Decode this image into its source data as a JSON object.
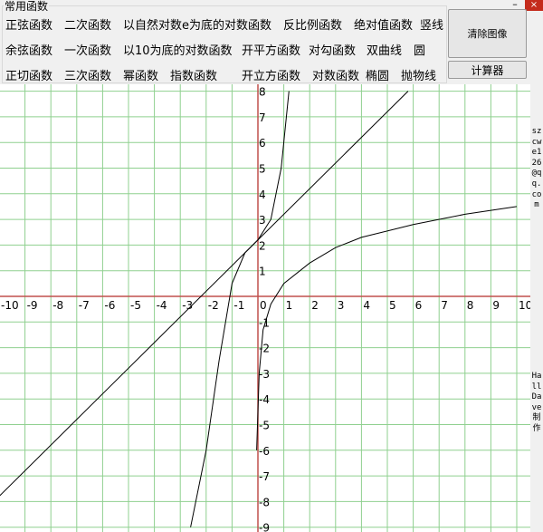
{
  "window": {
    "close_glyph": "×",
    "minimize_glyph": "–"
  },
  "group": {
    "title": "常用函数",
    "rows": [
      [
        "正弦函数",
        "二次函数",
        "以自然对数e为底的对数函数",
        "反比例函数",
        "绝对值函数",
        "竖线"
      ],
      [
        "余弦函数",
        "一次函数",
        "以10为底的对数函数",
        "开平方函数",
        "对勾函数",
        "双曲线",
        "圆"
      ],
      [
        "正切函数",
        "三次函数",
        "幂函数",
        "指数函数",
        "开立方函数",
        "对数函数",
        "椭圆",
        "抛物线"
      ]
    ]
  },
  "buttons": {
    "clear": "清除图像",
    "calculator": "计算器"
  },
  "side": {
    "email": "szcwe126@qq.com",
    "credit": "HallDave制作"
  },
  "chart_data": {
    "type": "line",
    "xlim": [
      -10,
      10
    ],
    "ylim": [
      -9,
      8
    ],
    "grid": true,
    "x_ticks": [
      -10,
      -9,
      -8,
      -7,
      -6,
      -5,
      -4,
      -3,
      -2,
      -1,
      0,
      1,
      2,
      3,
      4,
      5,
      6,
      7,
      8,
      9,
      10
    ],
    "y_ticks": [
      8,
      7,
      6,
      5,
      4,
      3,
      2,
      1,
      -1,
      -2,
      -3,
      -4,
      -5,
      -6,
      -7,
      -8,
      -9
    ],
    "series": [
      {
        "kind": "linear",
        "formula": "y = x + 2.2",
        "points": [
          [
            -10,
            -7.8
          ],
          [
            5.8,
            8
          ]
        ]
      },
      {
        "kind": "cubic-like",
        "points": [
          [
            -2.6,
            -9
          ],
          [
            -2,
            -6
          ],
          [
            -1.5,
            -2.5
          ],
          [
            -1,
            0.5
          ],
          [
            -0.5,
            1.7
          ],
          [
            0,
            2.2
          ],
          [
            0.5,
            3
          ],
          [
            0.9,
            5
          ],
          [
            1.2,
            8
          ]
        ]
      },
      {
        "kind": "log-like",
        "points": [
          [
            -0.05,
            -6
          ],
          [
            0.05,
            -3
          ],
          [
            0.2,
            -1.3
          ],
          [
            0.5,
            -0.3
          ],
          [
            1,
            0.5
          ],
          [
            2,
            1.3
          ],
          [
            3,
            1.9
          ],
          [
            4,
            2.3
          ],
          [
            6,
            2.8
          ],
          [
            8,
            3.2
          ],
          [
            10,
            3.5
          ]
        ]
      }
    ]
  }
}
